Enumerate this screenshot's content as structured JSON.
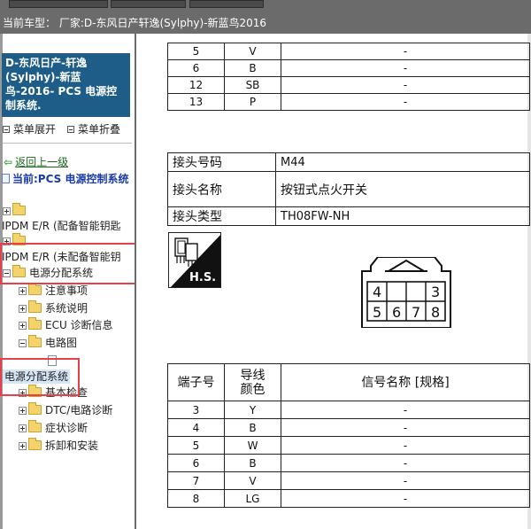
{
  "header": {
    "vehicle_label": "当前车型：",
    "vehicle_value": "厂家:D-东风日产轩逸(Sylphy)-新蓝鸟2016"
  },
  "sidebar": {
    "system_title": "D-东风日产-轩逸(Sylphy)-新蓝鸟-2016- PCS 电源控制系统.",
    "menu_expand": "菜单展开",
    "menu_collapse": "菜单折叠",
    "back_link": "返回上一级",
    "current_label": "当前:PCS 电源控制系统",
    "tree": {
      "node_ipdm_smart_key": "IPDM E/R (配备智能钥匙",
      "node_ipdm_no_smart_key": "IPDM E/R (未配备智能钥",
      "node_power_dist": "电源分配系统",
      "child_precautions": "注意事项",
      "child_system_desc": "系统说明",
      "child_ecu_diag": "ECU 诊断信息",
      "child_wiring": "电路图",
      "selected_page": "电源分配系统",
      "child_basic_check": "基本检查",
      "child_dtc_diag": "DTC/电路诊断",
      "child_symptom": "症状诊断",
      "child_removal": "拆卸和安装"
    }
  },
  "top_table": {
    "rows": [
      [
        "5",
        "V",
        "-"
      ],
      [
        "6",
        "B",
        "-"
      ],
      [
        "12",
        "SB",
        "-"
      ],
      [
        "13",
        "P",
        "-"
      ]
    ]
  },
  "connector": {
    "number_label": "接头号码",
    "number_value": "M44",
    "name_label": "接头名称",
    "name_value": "按钮式点火开关",
    "type_label": "接头类型",
    "type_value": "TH08FW-NH",
    "hs_label": "H.S.",
    "pins_top": [
      "4",
      "3"
    ],
    "pins_bottom": [
      "5",
      "6",
      "7",
      "8"
    ]
  },
  "pin_table": {
    "headers": [
      "端子号",
      "导线颜色",
      "信号名称 [规格]"
    ],
    "rows": [
      [
        "3",
        "Y",
        "-"
      ],
      [
        "4",
        "B",
        "-"
      ],
      [
        "5",
        "W",
        "-"
      ],
      [
        "6",
        "B",
        "-"
      ],
      [
        "7",
        "V",
        "-"
      ],
      [
        "8",
        "LG",
        "-"
      ]
    ]
  },
  "colors": {
    "title_bg": "#1d5d88",
    "highlight_red": "#e8404a",
    "back_link": "#1a6a1a",
    "current_text": "#1a3aa8"
  }
}
